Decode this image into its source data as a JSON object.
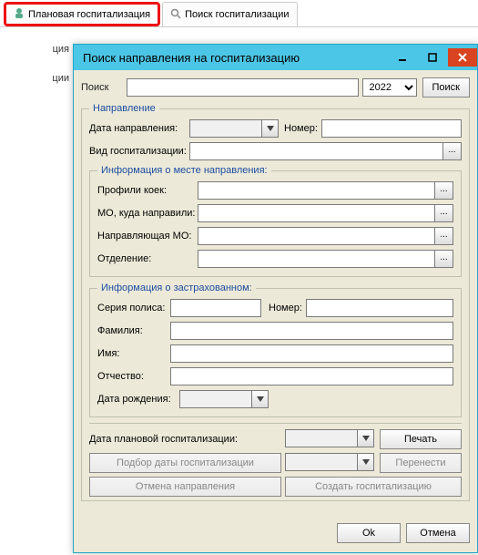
{
  "bg_tabs": {
    "tab1": {
      "icon": "person-icon",
      "label": "Плановая госпитализация"
    },
    "tab2": {
      "icon": "search-icon",
      "label": "Поиск госпитализации"
    }
  },
  "bg_sidebar": {
    "item1": "ция",
    "item2": "ции"
  },
  "dialog": {
    "title": "Поиск направления на госпитализацию",
    "search": {
      "label": "Поиск",
      "value": "",
      "year": "2022",
      "button": "Поиск"
    },
    "group_referral": {
      "legend": "Направление",
      "date_label": "Дата направления:",
      "date_value": "",
      "number_label": "Номер:",
      "number_value": "",
      "type_label": "Вид госпитализации:",
      "type_value": ""
    },
    "group_place": {
      "legend": "Информация о месте направления:",
      "beds_label": "Профили коек:",
      "beds_value": "",
      "mo_dest_label": "МО, куда направили:",
      "mo_dest_value": "",
      "mo_src_label": "Направляющая МО:",
      "mo_src_value": "",
      "dept_label": "Отделение:",
      "dept_value": ""
    },
    "group_insured": {
      "legend": "Информация о застрахованном:",
      "series_label": "Серия полиса:",
      "series_value": "",
      "number_label": "Номер:",
      "number_value": "",
      "lastname_label": "Фамилия:",
      "lastname_value": "",
      "firstname_label": "Имя:",
      "firstname_value": "",
      "patronymic_label": "Отчество:",
      "patronymic_value": "",
      "dob_label": "Дата рождения:",
      "dob_value": ""
    },
    "planned": {
      "date_label": "Дата плановой госпитализации:",
      "date_value": "",
      "print": "Печать",
      "pick_date": "Подбор даты госпитализации",
      "move": "Перенести",
      "cancel_referral": "Отмена направления",
      "create_hosp": "Создать госпитализацию"
    },
    "footer": {
      "ok": "Ok",
      "cancel": "Отмена"
    }
  }
}
